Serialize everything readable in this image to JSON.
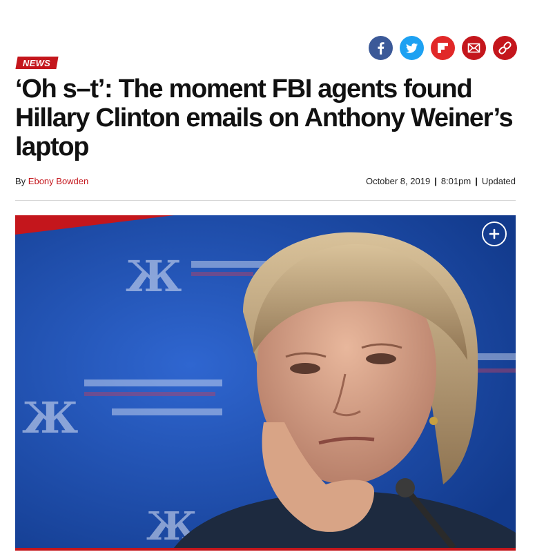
{
  "share": {
    "buttons": [
      {
        "name": "facebook",
        "icon": "facebook-icon",
        "color": "#3b5998"
      },
      {
        "name": "twitter",
        "icon": "twitter-icon",
        "color": "#1da1f2"
      },
      {
        "name": "flipboard",
        "icon": "flipboard-icon",
        "color": "#e12828"
      },
      {
        "name": "email",
        "icon": "email-icon",
        "color": "#c4161c"
      },
      {
        "name": "copy-link",
        "icon": "link-icon",
        "color": "#c4161c"
      }
    ]
  },
  "article": {
    "section_tag": "NEWS",
    "headline": "‘Oh s–t’: The moment FBI agents found Hillary Clinton emails on Anthony Weiner’s laptop",
    "byline_prefix": "By",
    "author": "Ebony Bowden",
    "date": "October 8, 2019",
    "time": "8:01pm",
    "updated_label": "Updated"
  },
  "media": {
    "expand_icon": "plus-icon"
  },
  "colors": {
    "brand_red": "#c4161c",
    "photo_background": "#1f4fb0"
  }
}
